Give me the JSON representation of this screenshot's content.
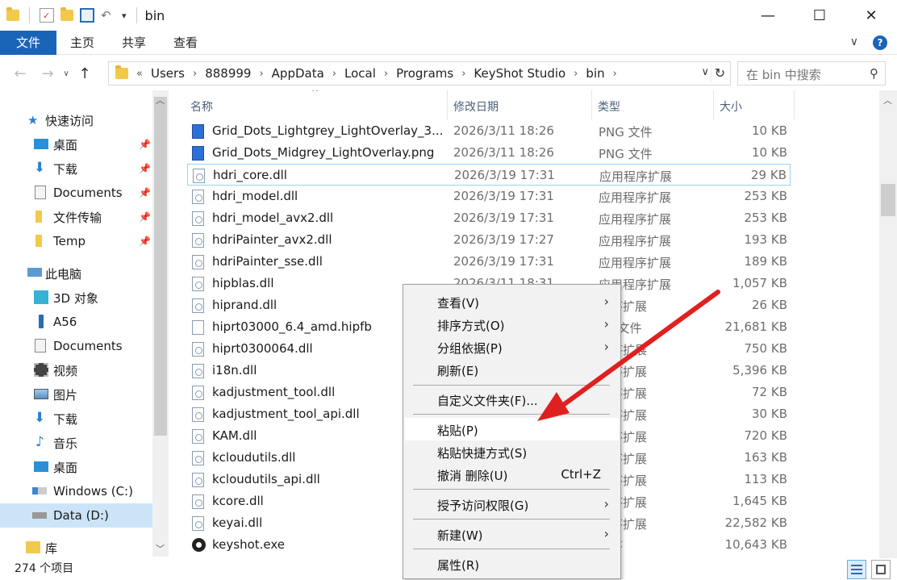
{
  "window": {
    "title": "bin",
    "minimize": "—",
    "maximize": "☐",
    "close": "✕"
  },
  "ribbon": {
    "tabs": [
      "文件",
      "主页",
      "共享",
      "查看"
    ],
    "collapse": "∨",
    "help": "?"
  },
  "address": {
    "prefix": "«",
    "crumbs": [
      "Users",
      "888999",
      "AppData",
      "Local",
      "Programs",
      "KeyShot Studio",
      "bin"
    ],
    "search_placeholder": "在 bin 中搜索"
  },
  "sidebar": {
    "items": [
      {
        "label": "快速访问",
        "icon": "star-icon",
        "pinned": false
      },
      {
        "label": "桌面",
        "icon": "desktop-icon",
        "pinned": true
      },
      {
        "label": "下载",
        "icon": "download-icon",
        "pinned": true
      },
      {
        "label": "Documents",
        "icon": "document-icon",
        "pinned": true
      },
      {
        "label": "文件传输",
        "icon": "folder-icon",
        "pinned": true
      },
      {
        "label": "Temp",
        "icon": "folder-icon",
        "pinned": true
      },
      {
        "label": "此电脑",
        "icon": "computer-icon",
        "pinned": false
      },
      {
        "label": "3D 对象",
        "icon": "cube-icon",
        "pinned": false
      },
      {
        "label": "A56",
        "icon": "phone-icon",
        "pinned": false
      },
      {
        "label": "Documents",
        "icon": "document-icon",
        "pinned": false
      },
      {
        "label": "视频",
        "icon": "video-icon",
        "pinned": false
      },
      {
        "label": "图片",
        "icon": "picture-icon",
        "pinned": false
      },
      {
        "label": "下载",
        "icon": "download-icon",
        "pinned": false
      },
      {
        "label": "音乐",
        "icon": "music-icon",
        "pinned": false
      },
      {
        "label": "桌面",
        "icon": "desktop-icon",
        "pinned": false
      },
      {
        "label": "Windows (C:)",
        "icon": "drive-icon",
        "pinned": false
      },
      {
        "label": "Data (D:)",
        "icon": "drive-icon",
        "pinned": false
      },
      {
        "label": "库",
        "icon": "library-icon",
        "pinned": false
      }
    ]
  },
  "columns": {
    "name": "名称",
    "date": "修改日期",
    "type": "类型",
    "size": "大小"
  },
  "files": [
    {
      "name": "Grid_Dots_Lightgrey_LightOverlay_3...",
      "date": "2026/3/11 18:26",
      "type": "PNG 文件",
      "size": "10 KB",
      "kind": "png"
    },
    {
      "name": "Grid_Dots_Midgrey_LightOverlay.png",
      "date": "2026/3/11 18:26",
      "type": "PNG 文件",
      "size": "10 KB",
      "kind": "png"
    },
    {
      "name": "hdri_core.dll",
      "date": "2026/3/19 17:31",
      "type": "应用程序扩展",
      "size": "29 KB",
      "kind": "dll"
    },
    {
      "name": "hdri_model.dll",
      "date": "2026/3/19 17:31",
      "type": "应用程序扩展",
      "size": "253 KB",
      "kind": "dll"
    },
    {
      "name": "hdri_model_avx2.dll",
      "date": "2026/3/19 17:31",
      "type": "应用程序扩展",
      "size": "253 KB",
      "kind": "dll"
    },
    {
      "name": "hdriPainter_avx2.dll",
      "date": "2026/3/19 17:27",
      "type": "应用程序扩展",
      "size": "193 KB",
      "kind": "dll"
    },
    {
      "name": "hdriPainter_sse.dll",
      "date": "2026/3/19 17:31",
      "type": "应用程序扩展",
      "size": "189 KB",
      "kind": "dll"
    },
    {
      "name": "hipblas.dll",
      "date": "2026/3/11 18:31",
      "type": "应用程序扩展",
      "size": "1,057 KB",
      "kind": "dll"
    },
    {
      "name": "hiprand.dll",
      "date": "",
      "type": "程序扩展",
      "size": "26 KB",
      "kind": "dll"
    },
    {
      "name": "hiprt03000_6.4_amd.hipfb",
      "date": "",
      "type": "FB 文件",
      "size": "21,681 KB",
      "kind": "file"
    },
    {
      "name": "hiprt0300064.dll",
      "date": "",
      "type": "程序扩展",
      "size": "750 KB",
      "kind": "dll"
    },
    {
      "name": "i18n.dll",
      "date": "",
      "type": "程序扩展",
      "size": "5,396 KB",
      "kind": "dll"
    },
    {
      "name": "kadjustment_tool.dll",
      "date": "",
      "type": "程序扩展",
      "size": "72 KB",
      "kind": "dll"
    },
    {
      "name": "kadjustment_tool_api.dll",
      "date": "",
      "type": "程序扩展",
      "size": "30 KB",
      "kind": "dll"
    },
    {
      "name": "KAM.dll",
      "date": "",
      "type": "程序扩展",
      "size": "720 KB",
      "kind": "dll"
    },
    {
      "name": "kcloudutils.dll",
      "date": "",
      "type": "程序扩展",
      "size": "163 KB",
      "kind": "dll"
    },
    {
      "name": "kcloudutils_api.dll",
      "date": "",
      "type": "程序扩展",
      "size": "113 KB",
      "kind": "dll"
    },
    {
      "name": "kcore.dll",
      "date": "",
      "type": "程序扩展",
      "size": "1,645 KB",
      "kind": "dll"
    },
    {
      "name": "keyai.dll",
      "date": "",
      "type": "程序扩展",
      "size": "22,582 KB",
      "kind": "dll"
    },
    {
      "name": "keyshot.exe",
      "date": "",
      "type": "程序",
      "size": "10,643 KB",
      "kind": "exe"
    }
  ],
  "context_menu": {
    "items": [
      {
        "label": "查看(V)",
        "submenu": true
      },
      {
        "label": "排序方式(O)",
        "submenu": true
      },
      {
        "label": "分组依据(P)",
        "submenu": true
      },
      {
        "label": "刷新(E)",
        "submenu": false
      },
      {
        "label": "自定义文件夹(F)...",
        "submenu": false
      },
      {
        "label": "粘贴(P)",
        "submenu": false,
        "hover": true
      },
      {
        "label": "粘贴快捷方式(S)",
        "submenu": false
      },
      {
        "label": "撤消 删除(U)",
        "submenu": false,
        "shortcut": "Ctrl+Z"
      },
      {
        "label": "授予访问权限(G)",
        "submenu": true
      },
      {
        "label": "新建(W)",
        "submenu": true
      },
      {
        "label": "属性(R)",
        "submenu": false
      }
    ]
  },
  "status": {
    "item_count": "274 个项目"
  },
  "colors": {
    "accent": "#1a64b8",
    "selection": "#cce4f7",
    "arrow": "#e02020"
  }
}
